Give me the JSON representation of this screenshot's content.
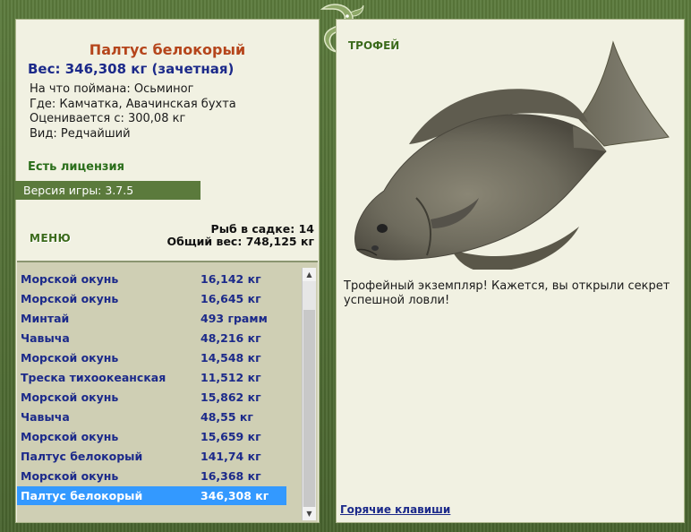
{
  "fish": {
    "title": "Палтус белокорый",
    "weight": "Вес: 346,308 кг (зачетная)",
    "info": [
      "На что поймана: Осьминог",
      "Где: Камчатка, Авачинская бухта",
      "Оценивается с: 300,08 кг",
      "Вид: Редчайший"
    ],
    "license": "Есть лицензия",
    "version": "Версия игры: 3.7.5"
  },
  "menu_label": "МЕНЮ",
  "net": {
    "count": "Рыб в садке: 14",
    "total": "Общий вес: 748,125 кг"
  },
  "catch_list": [
    {
      "name": "Морской окунь",
      "weight": "16,142 кг"
    },
    {
      "name": "Морской окунь",
      "weight": "16,645 кг"
    },
    {
      "name": "Минтай",
      "weight": "493 грамм"
    },
    {
      "name": "Чавыча",
      "weight": "48,216 кг"
    },
    {
      "name": "Морской окунь",
      "weight": "14,548 кг"
    },
    {
      "name": "Треска тихоокеанская",
      "weight": "11,512 кг"
    },
    {
      "name": "Морской окунь",
      "weight": "15,862 кг"
    },
    {
      "name": "Чавыча",
      "weight": "48,55 кг"
    },
    {
      "name": "Морской окунь",
      "weight": "15,659 кг"
    },
    {
      "name": "Палтус белокорый",
      "weight": "141,74 кг"
    },
    {
      "name": "Морской окунь",
      "weight": "16,368 кг"
    },
    {
      "name": "Палтус белокорый",
      "weight": "346,308 кг"
    }
  ],
  "selected_index": 11,
  "trophy": {
    "label": "ТРОФЕЙ",
    "text": "Трофейный экземпляр! Кажется, вы открыли секрет успешной ловли!"
  },
  "hotkeys_label": "Горячие клавиши",
  "icons": [
    "fish-logo-icon",
    "halibut-image",
    "scroll-up-icon",
    "scroll-down-icon"
  ],
  "colors": {
    "frame": "#4f6a34",
    "panel": "#f1f1e2",
    "title": "#b5451b",
    "link": "#1c2a8a",
    "selection": "#3399ff"
  }
}
